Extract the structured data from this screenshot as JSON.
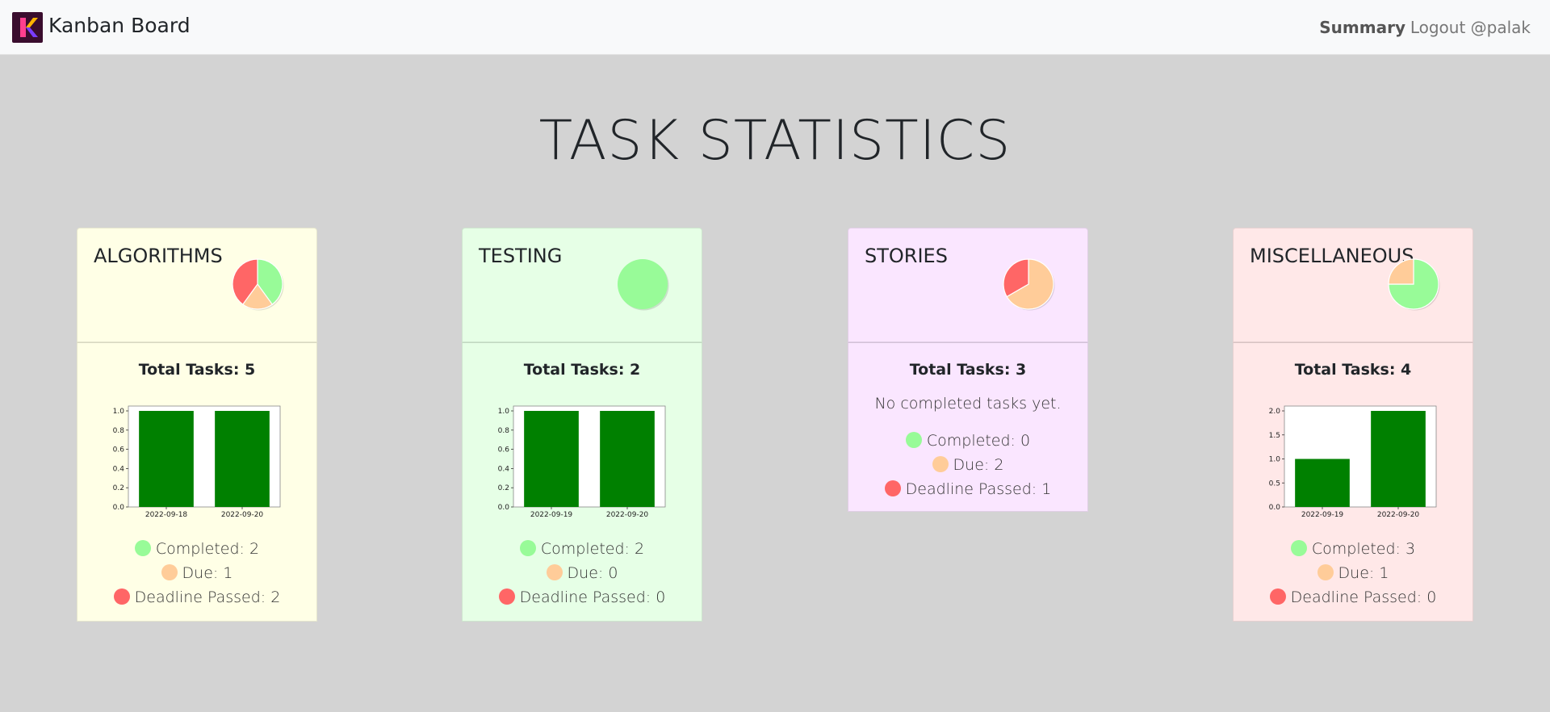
{
  "navbar": {
    "brand": "Kanban Board",
    "summary_link": "Summary",
    "logout_link": "Logout @palak"
  },
  "page": {
    "title": "TASK STATISTICS"
  },
  "colors": {
    "completed": "#98fb98",
    "due": "#ffcc99",
    "deadline_passed": "#ff6666",
    "bar": "#008000"
  },
  "cards": [
    {
      "name": "ALGORITHMS",
      "bg": "#ffffe6",
      "total_label": "Total Tasks: 5",
      "completed_label": "Completed: 2",
      "due_label": "Due: 1",
      "passed_label": "Deadline Passed: 2",
      "pie": [
        2,
        1,
        2
      ]
    },
    {
      "name": "TESTING",
      "bg": "#e6ffe6",
      "total_label": "Total Tasks: 2",
      "completed_label": "Completed: 2",
      "due_label": "Due: 0",
      "passed_label": "Deadline Passed: 0",
      "pie": [
        2,
        0,
        0
      ]
    },
    {
      "name": "STORIES",
      "bg": "#fae6ff",
      "total_label": "Total Tasks: 3",
      "no_completed": "No completed tasks yet.",
      "completed_label": "Completed: 0",
      "due_label": "Due: 2",
      "passed_label": "Deadline Passed: 1",
      "pie": [
        0,
        2,
        1
      ]
    },
    {
      "name": "MISCELLANEOUS",
      "bg": "#ffe8e8",
      "total_label": "Total Tasks: 4",
      "completed_label": "Completed: 3",
      "due_label": "Due: 1",
      "passed_label": "Deadline Passed: 0",
      "pie": [
        3,
        1,
        0
      ]
    }
  ],
  "chart_data": [
    {
      "type": "bar",
      "chart": "ALGORITHMS",
      "categories": [
        "2022-09-18",
        "2022-09-20"
      ],
      "values": [
        1,
        1
      ],
      "ylim": [
        0,
        1.0
      ],
      "yticks": [
        "0.0",
        "0.2",
        "0.4",
        "0.6",
        "0.8",
        "1.0"
      ]
    },
    {
      "type": "bar",
      "chart": "TESTING",
      "categories": [
        "2022-09-19",
        "2022-09-20"
      ],
      "values": [
        1,
        1
      ],
      "ylim": [
        0,
        1.0
      ],
      "yticks": [
        "0.0",
        "0.2",
        "0.4",
        "0.6",
        "0.8",
        "1.0"
      ]
    },
    {
      "type": "bar",
      "chart": "MISCELLANEOUS",
      "categories": [
        "2022-09-19",
        "2022-09-20"
      ],
      "values": [
        1,
        2
      ],
      "ylim": [
        0,
        2.0
      ],
      "yticks": [
        "0.0",
        "0.5",
        "1.0",
        "1.5",
        "2.0"
      ]
    }
  ]
}
